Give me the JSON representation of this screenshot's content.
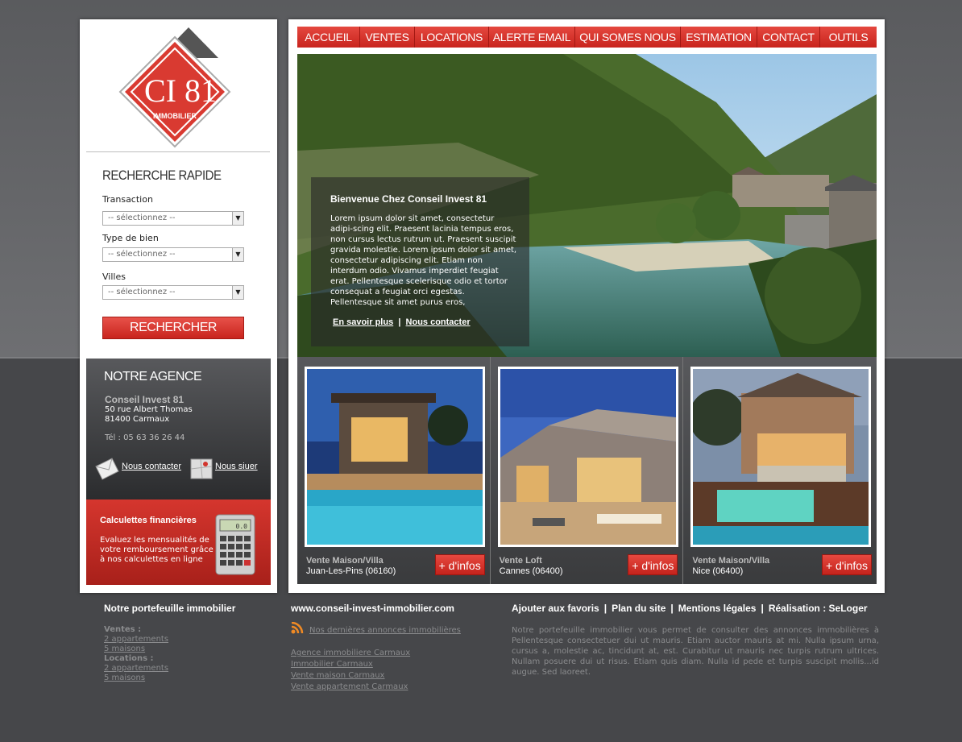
{
  "brand": {
    "logo_text": "CI 81",
    "logo_sub": "IMMOBILIER"
  },
  "search": {
    "title": "RECHERCHE RAPIDE",
    "transaction_label": "Transaction",
    "transaction_value": "-- sélectionnez --",
    "type_label": "Type de bien",
    "type_value": "-- sélectionnez --",
    "villes_label": "Villes",
    "villes_value": "-- sélectionnez --",
    "button": "RECHERCHER"
  },
  "agency": {
    "title": "NOTRE AGENCE",
    "name": "Conseil Invest 81",
    "address1": "50 rue Albert Thomas",
    "address2": "81400 Carmaux",
    "tel": "Tél : 05 63 36 26 44",
    "contact_link": "Nous contacter",
    "locate_link": "Nous siuer"
  },
  "calculettes": {
    "title": "Calculettes financières",
    "text": "Evaluez les mensualités de votre remboursement grâce à nos calculettes en ligne",
    "screen": "0.0"
  },
  "nav": [
    "ACCUEIL",
    "VENTES",
    "LOCATIONS",
    "ALERTE EMAIL",
    "QUI SOMES NOUS",
    "ESTIMATION",
    "CONTACT",
    "OUTILS"
  ],
  "hero": {
    "title": "Bienvenue Chez Conseil Invest 81",
    "text": "Lorem ipsum dolor sit amet, consectetur adipi-scing elit. Praesent lacinia tempus eros, non cursus lectus rutrum ut. Praesent suscipit gravida molestie. Lorem ipsum dolor sit amet, consectetur adipiscing elit. Etiam non interdum odio. Vivamus imperdiet feugiat erat. Pellentesque scelerisque odio et tortor consequat a feugiat orci egestas. Pellentesque sit amet purus eros,",
    "link1": "En savoir plus",
    "link2": "Nous contacter",
    "separator": "|"
  },
  "listings": [
    {
      "type": "Vente Maison/Villa",
      "location": "Juan-Les-Pins (06160)",
      "button": "+ d'infos"
    },
    {
      "type": "Vente Loft",
      "location": "Cannes (06400)",
      "button": "+ d'infos"
    },
    {
      "type": "Vente Maison/Villa",
      "location": "Nice (06400)",
      "button": "+ d'infos"
    }
  ],
  "footer": {
    "col1_title": "Notre portefeuille immobilier",
    "ventes_label": "Ventes :",
    "ventes_items": [
      "2 appartements",
      "5 maisons"
    ],
    "locations_label": "Locations :",
    "locations_items": [
      "2 appartements",
      "5 maisons"
    ],
    "col2_title": "www.conseil-invest-immobilier.com",
    "rss_link": "Nos dernières annonces immobilières",
    "links": [
      "Agence immobiliere Carmaux",
      "Immobilier Carmaux",
      "Vente maison Carmaux",
      "Vente appartement Carmaux"
    ],
    "col3_links": [
      "Ajouter aux favoris",
      "Plan du site",
      "Mentions légales",
      "Réalisation : SeLoger"
    ],
    "col3_sep": "|",
    "col3_text": "Notre portefeuille immobilier vous permet de consulter des annonces immobilières à Pellentesque consectetuer dui ut mauris. Etiam auctor mauris at mi. Nulla ipsum urna, cursus a, molestie ac, tincidunt at, est. Curabitur ut mauris nec turpis rutrum ultrices. Nullam posuere dui ut risus. Etiam quis diam. Nulla id pede et turpis suscipit mollis...id augue. Sed laoreet."
  },
  "colors": {
    "accent": "#d2342c",
    "dark": "#46474a"
  }
}
